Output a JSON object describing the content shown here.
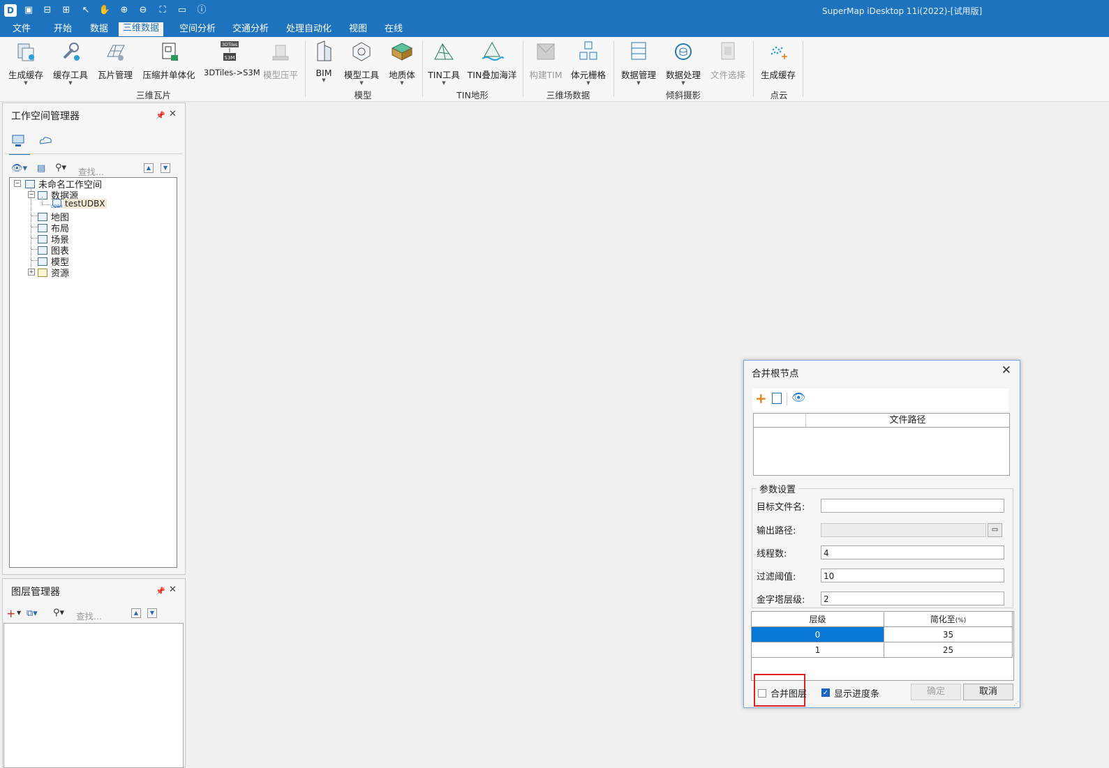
{
  "app": {
    "title": "SuperMap iDesktop 11i(2022)-[试用版]"
  },
  "menu": [
    "文件",
    "开始",
    "数据",
    "三维数据",
    "空间分析",
    "交通分析",
    "处理自动化",
    "视图",
    "在线"
  ],
  "ribbon": {
    "buttons": [
      "生成缓存",
      "缓存工具",
      "瓦片管理",
      "压缩并单体化",
      "3DTiles->S3M",
      "模型压平",
      "BIM",
      "模型工具",
      "地质体",
      "TIN工具",
      "TIN叠加海洋",
      "构建TIM",
      "体元栅格",
      "数据管理",
      "数据处理",
      "文件选择",
      "生成缓存"
    ],
    "groups": [
      "三维瓦片",
      "模型",
      "TIN地形",
      "三维场数据",
      "倾斜摄影",
      "点云"
    ],
    "icon_badges": {
      "tiles": "3DTiles",
      "s3m": "S3M"
    }
  },
  "workspace": {
    "title": "工作空间管理器",
    "search_placeholder": "查找...",
    "tree": {
      "root": "未命名工作空间",
      "datasource": "数据源",
      "datasource_item": "testUDBX",
      "udbx_badge": "UDBX",
      "items": [
        "地图",
        "布局",
        "场景",
        "图表",
        "模型",
        "资源"
      ]
    }
  },
  "layers": {
    "title": "图层管理器",
    "search_placeholder": "查找..."
  },
  "dialog": {
    "title": "合并根节点",
    "file_table_header": "文件路径",
    "params_title": "参数设置",
    "fields": {
      "target_name": {
        "label": "目标文件名:",
        "value": ""
      },
      "output_path": {
        "label": "输出路径:",
        "value": ""
      },
      "threads": {
        "label": "线程数:",
        "value": "4"
      },
      "filter": {
        "label": "过滤阈值:",
        "value": "10"
      },
      "pyramid": {
        "label": "金字塔层级:",
        "value": "2"
      }
    },
    "level_table": {
      "headers": [
        "层级",
        "简化至",
        "(%)"
      ],
      "rows": [
        [
          "0",
          "35"
        ],
        [
          "1",
          "25"
        ]
      ]
    },
    "merge_layers": {
      "label": "合并图层",
      "checked": false
    },
    "show_progress": {
      "label": "显示进度条",
      "checked": true
    },
    "ok": "确定",
    "cancel": "取消"
  }
}
